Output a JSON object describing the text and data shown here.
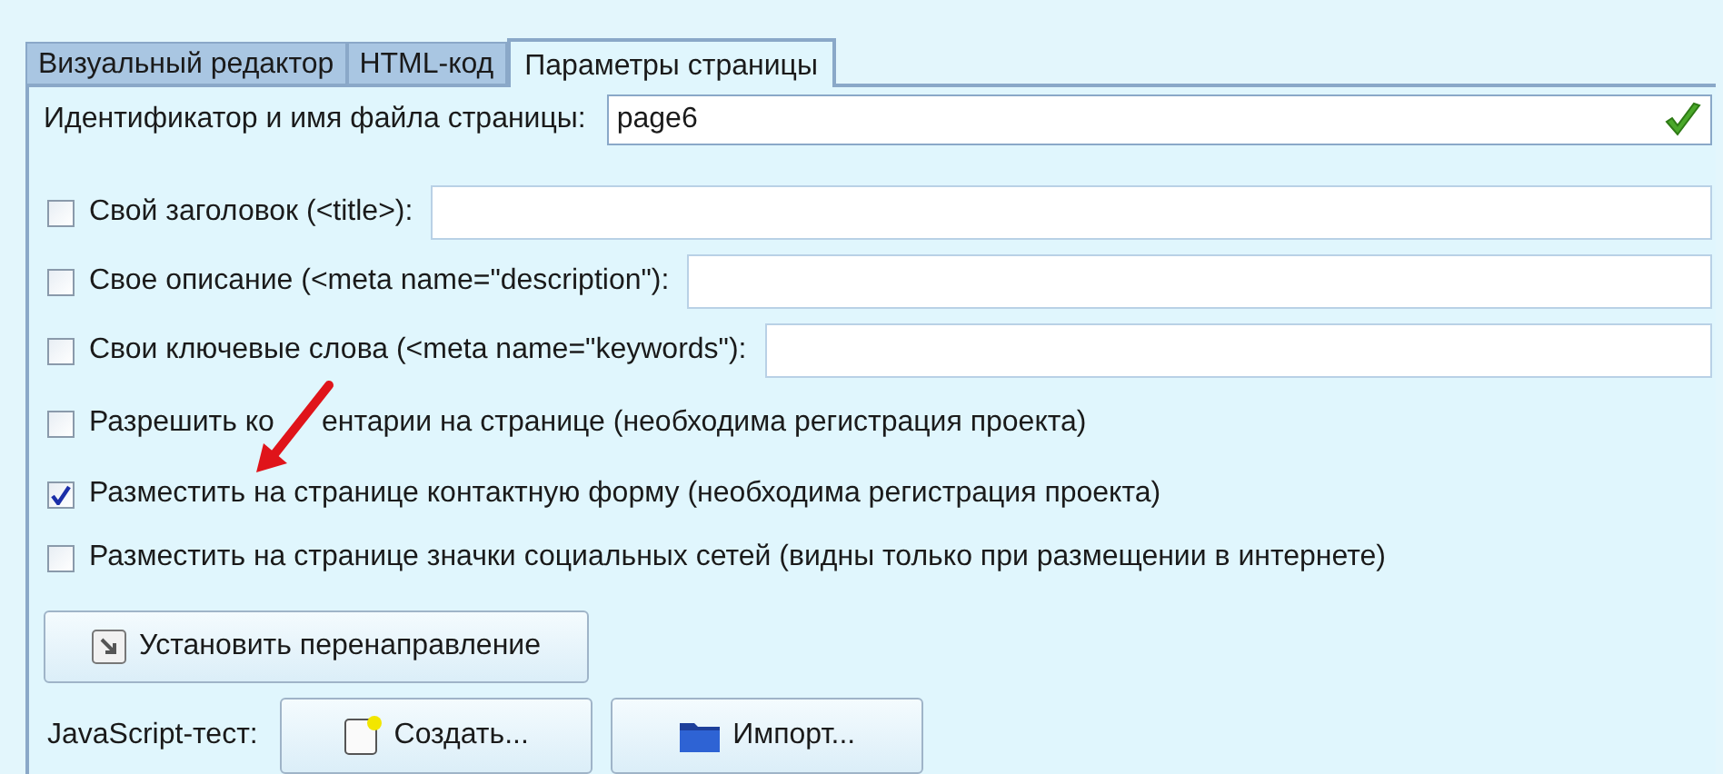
{
  "tabs": [
    {
      "label": "Визуальный редактор",
      "selected": false
    },
    {
      "label": "HTML-код",
      "selected": false
    },
    {
      "label": "Параметры страницы",
      "selected": true
    }
  ],
  "page_id": {
    "label": "Идентификатор и имя файла страницы:",
    "value": "page6",
    "valid": true
  },
  "options": [
    {
      "kind": "field",
      "label": "Свой заголовок (<title>):",
      "checked": false
    },
    {
      "kind": "field",
      "label": "Свое описание (<meta name=\"description\"):",
      "checked": false
    },
    {
      "kind": "field",
      "label": "Свои ключевые слова (<meta name=\"keywords\"):",
      "checked": false
    },
    {
      "kind": "check",
      "label": [
        "Разрешить ко",
        "ентарии на странице (необходима регистрация проекта)"
      ],
      "checked": false
    },
    {
      "kind": "check",
      "label": "Разместить на странице контактную форму (необходима регистрация проекта)",
      "checked": true
    },
    {
      "kind": "check",
      "label": "Разместить на странице значки социальных сетей (видны только при размещении в интернете)",
      "checked": false
    }
  ],
  "redirect_button": "Установить перенаправление",
  "javascript": {
    "label": "JavaScript-тест:",
    "buttons": [
      {
        "kind": "create",
        "label": "Создать..."
      },
      {
        "kind": "import",
        "label": "Импорт..."
      }
    ]
  }
}
